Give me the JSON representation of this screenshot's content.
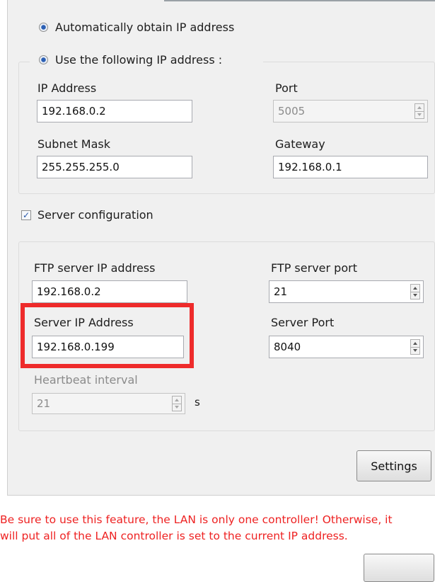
{
  "ip_mode": {
    "auto_label": "Automatically obtain IP address",
    "manual_label": "Use the following IP address :",
    "selected": "manual"
  },
  "network": {
    "ip_address": {
      "label": "IP Address",
      "value": "192.168.0.2"
    },
    "port": {
      "label": "Port",
      "value": "5005",
      "disabled": true
    },
    "subnet_mask": {
      "label": "Subnet Mask",
      "value": "255.255.255.0"
    },
    "gateway": {
      "label": "Gateway",
      "value": "192.168.0.1"
    }
  },
  "server_config": {
    "checkbox_label": "Server configuration",
    "checked": true,
    "ftp_ip": {
      "label": "FTP server IP address",
      "value": "192.168.0.2"
    },
    "ftp_port": {
      "label": "FTP server port",
      "value": "21"
    },
    "server_ip": {
      "label": "Server IP Address",
      "value": "192.168.0.199"
    },
    "server_port": {
      "label": "Server Port",
      "value": "8040"
    },
    "heartbeat": {
      "label": "Heartbeat interval",
      "value": "21",
      "unit": "s",
      "disabled": true
    }
  },
  "buttons": {
    "settings": "Settings"
  },
  "warning": {
    "line1": "Be sure to use this feature, the LAN is only one controller! Otherwise, it",
    "line2": "will put all of the LAN controller is set to the current IP address."
  },
  "colors": {
    "highlight": "#ee2b2b",
    "warning_text": "#ee2222",
    "radio_dot": "#2b5fb4"
  }
}
